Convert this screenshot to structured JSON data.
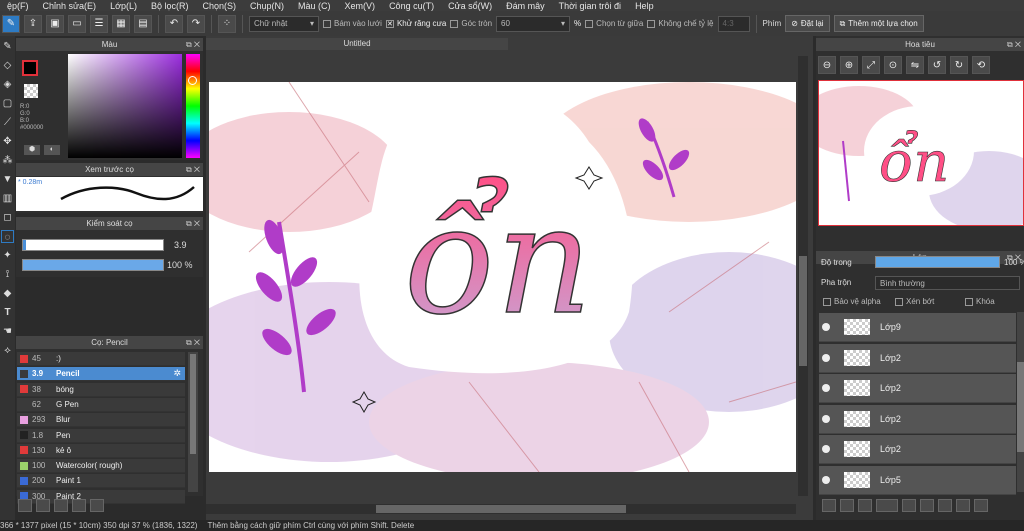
{
  "menu": [
    "ệp(F)",
    "Chỉnh sửa(E)",
    "Lớp(L)",
    "Bộ lọc(R)",
    "Chọn(S)",
    "Chụp(N)",
    "Màu (C)",
    "Xem(V)",
    "Công cụ(T)",
    "Cửa sổ(W)",
    "Đám mây",
    "Thời gian trôi đi",
    "Help"
  ],
  "toolbar": {
    "shape": "Chữ nhật",
    "snap_grid": "Bám vào lưới",
    "antialias": "Khử răng cưa",
    "corner_label": "Góc tròn",
    "corner_value": "60",
    "percent": "%",
    "select_from_center": "Chọn từ giữa",
    "no_ratio": "Không chế tỷ lệ",
    "ratio_field": "4:3",
    "keys_label": "Phím",
    "reset_button": "Đặt lại",
    "add_selection_button": "Thêm một lựa chọn"
  },
  "color_panel": {
    "title": "Màu",
    "r": "R:0",
    "g": "G:0",
    "b": "B:0",
    "hex": "#000000"
  },
  "preview_panel": {
    "title": "Xem trước cọ",
    "size": "* 0.28m"
  },
  "control_panel": {
    "title": "Kiểm soát cọ",
    "size_value": "3.9",
    "opacity_value": "100 %",
    "size_fill": 0.02,
    "opacity_fill": 1.0
  },
  "brush_panel": {
    "title": "Cọ: Pencil",
    "items": [
      {
        "size": "45",
        "name": ":)",
        "color": "#e03a3a"
      },
      {
        "size": "3.9",
        "name": "Pencil",
        "color": "#3a3a3a"
      },
      {
        "size": "38",
        "name": "bóng",
        "color": "#e03a3a"
      },
      {
        "size": "62",
        "name": "G Pen",
        "color": "#3a3a3a"
      },
      {
        "size": "293",
        "name": "Blur",
        "color": "#e8a0e0"
      },
      {
        "size": "1.8",
        "name": "Pen",
        "color": "#222222"
      },
      {
        "size": "130",
        "name": "kẻ ô",
        "color": "#e03a3a"
      },
      {
        "size": "100",
        "name": "Watercolor( rough)",
        "color": "#9bd36b"
      },
      {
        "size": "200",
        "name": "Paint 1",
        "color": "#3a6ad6"
      },
      {
        "size": "300",
        "name": "Paint 2",
        "color": "#3a6ad6"
      }
    ]
  },
  "canvas": {
    "tab_title": "Untitled",
    "artwork_text": "ổn"
  },
  "navigator": {
    "title": "Hoa tiêu"
  },
  "layer_panel": {
    "title": "Lớp",
    "opacity_label": "Độ trong",
    "opacity_value": "100 %",
    "blend_label": "Pha trộn",
    "blend_value": "Bình thường",
    "protect_alpha": "Bảo vệ alpha",
    "clip": "Xén bớt",
    "lock": "Khóa",
    "layers": [
      "Lớp9",
      "Lớp2",
      "Lớp2",
      "Lớp2",
      "Lớp2",
      "Lớp5"
    ]
  },
  "status": {
    "dims": "366 * 1377 pixel  (15 * 10cm)  350 dpi  37 %  (1836, 1322)",
    "hint": "Thêm bằng cách giữ phím Ctrl cùng với phím Shift. Delete"
  },
  "colors": {
    "accent": "#2e7bc4",
    "pink": "#e8608f",
    "purple": "#b03cc8"
  }
}
